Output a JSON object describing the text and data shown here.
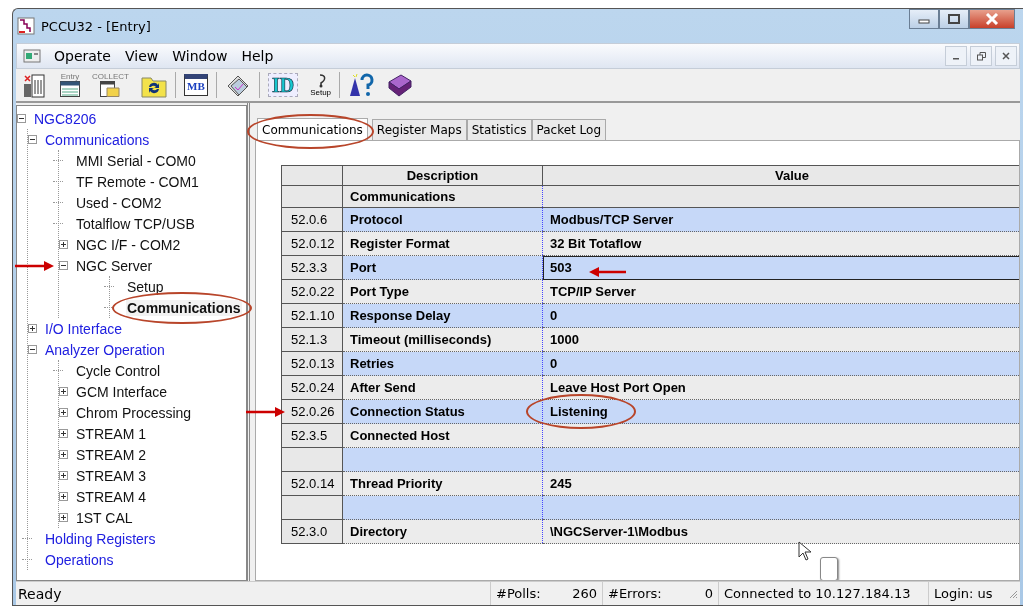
{
  "window": {
    "title": "PCCU32 - [Entry]"
  },
  "menu": [
    "Operate",
    "View",
    "Window",
    "Help"
  ],
  "toolbar": [
    {
      "kind": "device"
    },
    {
      "kind": "entry",
      "caption": "Entry"
    },
    {
      "kind": "collect",
      "caption": "COLLECT"
    },
    {
      "kind": "refresh"
    },
    {
      "kind": "separator"
    },
    {
      "kind": "modbus",
      "caption": "MB"
    },
    {
      "kind": "separator"
    },
    {
      "kind": "reports"
    },
    {
      "kind": "separator"
    },
    {
      "kind": "id",
      "caption": "ID"
    },
    {
      "kind": "setup",
      "caption": "Setup"
    },
    {
      "kind": "separator"
    },
    {
      "kind": "wizard"
    },
    {
      "kind": "book"
    }
  ],
  "tree": [
    {
      "label": "NGC8206",
      "kind": "category",
      "expanded": true,
      "selected": false,
      "children": [
        {
          "label": "Communications",
          "kind": "category",
          "expanded": true,
          "selected": false,
          "children": [
            {
              "label": "MMI Serial - COM0",
              "kind": "item",
              "selected": false
            },
            {
              "label": "TF Remote - COM1",
              "kind": "item",
              "selected": false
            },
            {
              "label": "Used - COM2",
              "kind": "item",
              "selected": false
            },
            {
              "label": "Totalflow TCP/USB",
              "kind": "item",
              "selected": false
            },
            {
              "label": "NGC I/F - COM2",
              "kind": "item",
              "expanded": false,
              "selected": false
            },
            {
              "label": "NGC Server",
              "kind": "item",
              "expanded": true,
              "selected": false,
              "arrow": true,
              "children": [
                {
                  "label": "Setup",
                  "kind": "item",
                  "selected": false
                },
                {
                  "label": "Communications",
                  "kind": "item",
                  "selected": true,
                  "circled": true
                }
              ]
            }
          ]
        },
        {
          "label": "I/O Interface",
          "kind": "category",
          "expanded": false,
          "selected": false
        },
        {
          "label": "Analyzer Operation",
          "kind": "category",
          "expanded": true,
          "selected": false,
          "children": [
            {
              "label": "Cycle Control",
              "kind": "item",
              "selected": false
            },
            {
              "label": "GCM Interface",
              "kind": "item",
              "expanded": false,
              "selected": false
            },
            {
              "label": "Chrom Processing",
              "kind": "item",
              "expanded": false,
              "selected": false
            },
            {
              "label": "STREAM 1",
              "kind": "item",
              "expanded": false,
              "selected": false
            },
            {
              "label": "STREAM 2",
              "kind": "item",
              "expanded": false,
              "selected": false
            },
            {
              "label": "STREAM 3",
              "kind": "item",
              "expanded": false,
              "selected": false
            },
            {
              "label": "STREAM 4",
              "kind": "item",
              "expanded": false,
              "selected": false
            },
            {
              "label": "1ST CAL",
              "kind": "item",
              "expanded": false,
              "selected": false
            }
          ]
        },
        {
          "label": "Holding Registers",
          "kind": "category",
          "selected": false
        },
        {
          "label": "Operations",
          "kind": "category",
          "selected": false
        }
      ]
    }
  ],
  "tabs": [
    {
      "label": "Communications",
      "selected": true,
      "circled": true
    },
    {
      "label": "Register Maps",
      "selected": false
    },
    {
      "label": "Statistics",
      "selected": false
    },
    {
      "label": "Packet Log",
      "selected": false
    }
  ],
  "table": {
    "columns": [
      "Description",
      "Value"
    ],
    "rows": [
      {
        "kind": "section",
        "description": "Communications",
        "selected": false
      },
      {
        "kind": "field",
        "id": "52.0.6",
        "description": "Protocol",
        "value": "Modbus/TCP Server",
        "selected": false
      },
      {
        "kind": "field",
        "id": "52.0.12",
        "description": "Register Format",
        "value": "32 Bit Totaflow",
        "selected": false
      },
      {
        "kind": "field",
        "id": "52.3.3",
        "description": "Port",
        "value": "503",
        "selected": true,
        "arrow_after": true
      },
      {
        "kind": "field",
        "id": "52.0.22",
        "description": "Port Type",
        "value": "TCP/IP Server",
        "selected": false
      },
      {
        "kind": "field",
        "id": "52.1.10",
        "description": "Response Delay",
        "value": "0",
        "selected": false
      },
      {
        "kind": "field",
        "id": "52.1.3",
        "description": "Timeout (milliseconds)",
        "value": "1000",
        "selected": false
      },
      {
        "kind": "field",
        "id": "52.0.13",
        "description": "Retries",
        "value": "0",
        "selected": false
      },
      {
        "kind": "field",
        "id": "52.0.24",
        "description": "After Send",
        "value": "Leave Host Port Open",
        "selected": false
      },
      {
        "kind": "field",
        "id": "52.0.26",
        "description": "Connection Status",
        "value": "Listening",
        "selected": false,
        "arrow_before": true,
        "circled": true
      },
      {
        "kind": "field",
        "id": "52.3.5",
        "description": "Connected Host",
        "selected": false
      },
      {
        "kind": "field",
        "selected": false
      },
      {
        "kind": "field",
        "id": "52.0.14",
        "description": "Thread Priority",
        "value": "245",
        "selected": false
      },
      {
        "kind": "field",
        "selected": false
      },
      {
        "kind": "field",
        "id": "52.3.0",
        "description": "Directory",
        "value": "\\NGCServer-1\\Modbus",
        "selected": false
      }
    ]
  },
  "status_bar": {
    "message": "Ready",
    "polls_label": "#Polls:",
    "polls": "260",
    "errors_label": "#Errors:",
    "errors": "0",
    "connection": "Connected to 10.127.184.13",
    "login": "Login: us"
  }
}
